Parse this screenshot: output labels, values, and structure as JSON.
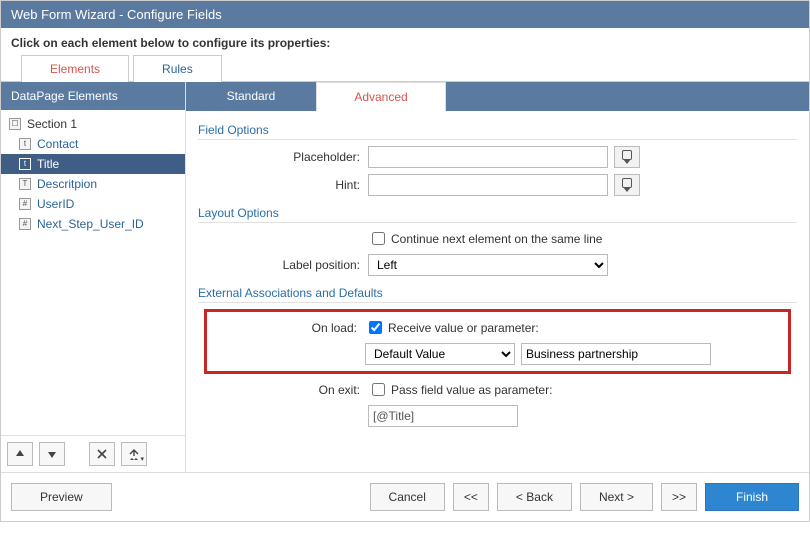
{
  "title": "Web Form Wizard - Configure Fields",
  "instruction": "Click on each element below to configure its properties:",
  "maintabs": {
    "elements": "Elements",
    "rules": "Rules"
  },
  "activeMainTab": "elements",
  "sidebar": {
    "header": "DataPage Elements",
    "items": [
      {
        "label": "Section 1",
        "type": "section"
      },
      {
        "label": "Contact",
        "type": "t"
      },
      {
        "label": "Title",
        "type": "t"
      },
      {
        "label": "Descritpion",
        "type": "T"
      },
      {
        "label": "UserID",
        "type": "hash"
      },
      {
        "label": "Next_Step_User_ID",
        "type": "hash"
      }
    ],
    "selectedIndex": 2
  },
  "subtabs": {
    "standard": "Standard",
    "advanced": "Advanced"
  },
  "activeSubtab": "advanced",
  "panel": {
    "fieldOptionsHead": "Field Options",
    "placeholderLabel": "Placeholder:",
    "placeholderValue": "",
    "hintLabel": "Hint:",
    "hintValue": "",
    "layoutOptionsHead": "Layout Options",
    "continueLabel": "Continue next element on the same line",
    "continueChecked": false,
    "labelPositionLabel": "Label position:",
    "labelPositionValue": "Left",
    "externalHead": "External Associations and Defaults",
    "onLoadLabel": "On load:",
    "onLoadCheckLabel": "Receive value or parameter:",
    "onLoadChecked": true,
    "onLoadModeValue": "Default Value",
    "onLoadParamValue": "Business partnership",
    "onExitLabel": "On exit:",
    "onExitCheckLabel": "Pass field value as parameter:",
    "onExitChecked": false,
    "onExitParamValue": "[@Title]"
  },
  "footer": {
    "preview": "Preview",
    "cancel": "Cancel",
    "first": "<<",
    "back": "< Back",
    "next": "Next >",
    "last": ">>",
    "finish": "Finish"
  }
}
